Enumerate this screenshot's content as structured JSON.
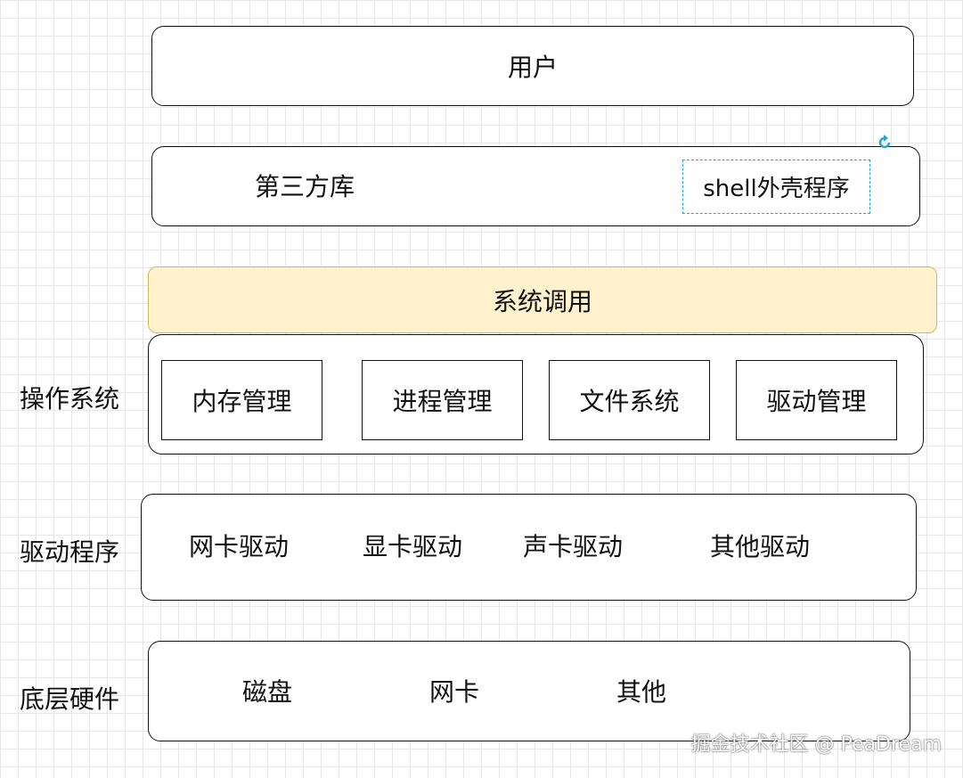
{
  "layers": {
    "user": "用户",
    "libs": {
      "third_party": "第三方库",
      "shell": "shell外壳程序"
    },
    "syscall": "系统调用",
    "os": {
      "label": "操作系统",
      "modules": [
        "内存管理",
        "进程管理",
        "文件系统",
        "驱动管理"
      ]
    },
    "drivers": {
      "label": "驱动程序",
      "items": [
        "网卡驱动",
        "显卡驱动",
        "声卡驱动",
        "其他驱动"
      ]
    },
    "hardware": {
      "label": "底层硬件",
      "items": [
        "磁盘",
        "网卡",
        "其他"
      ]
    }
  },
  "watermark": "掘金技术社区 @ PeaDream",
  "colors": {
    "syscall_fill": "#fff2cc",
    "syscall_border": "#d6b656",
    "selection": "#29a3d6",
    "grid": "#e6e6e6"
  },
  "icons": {
    "rotate_handle": "rotate-icon"
  }
}
